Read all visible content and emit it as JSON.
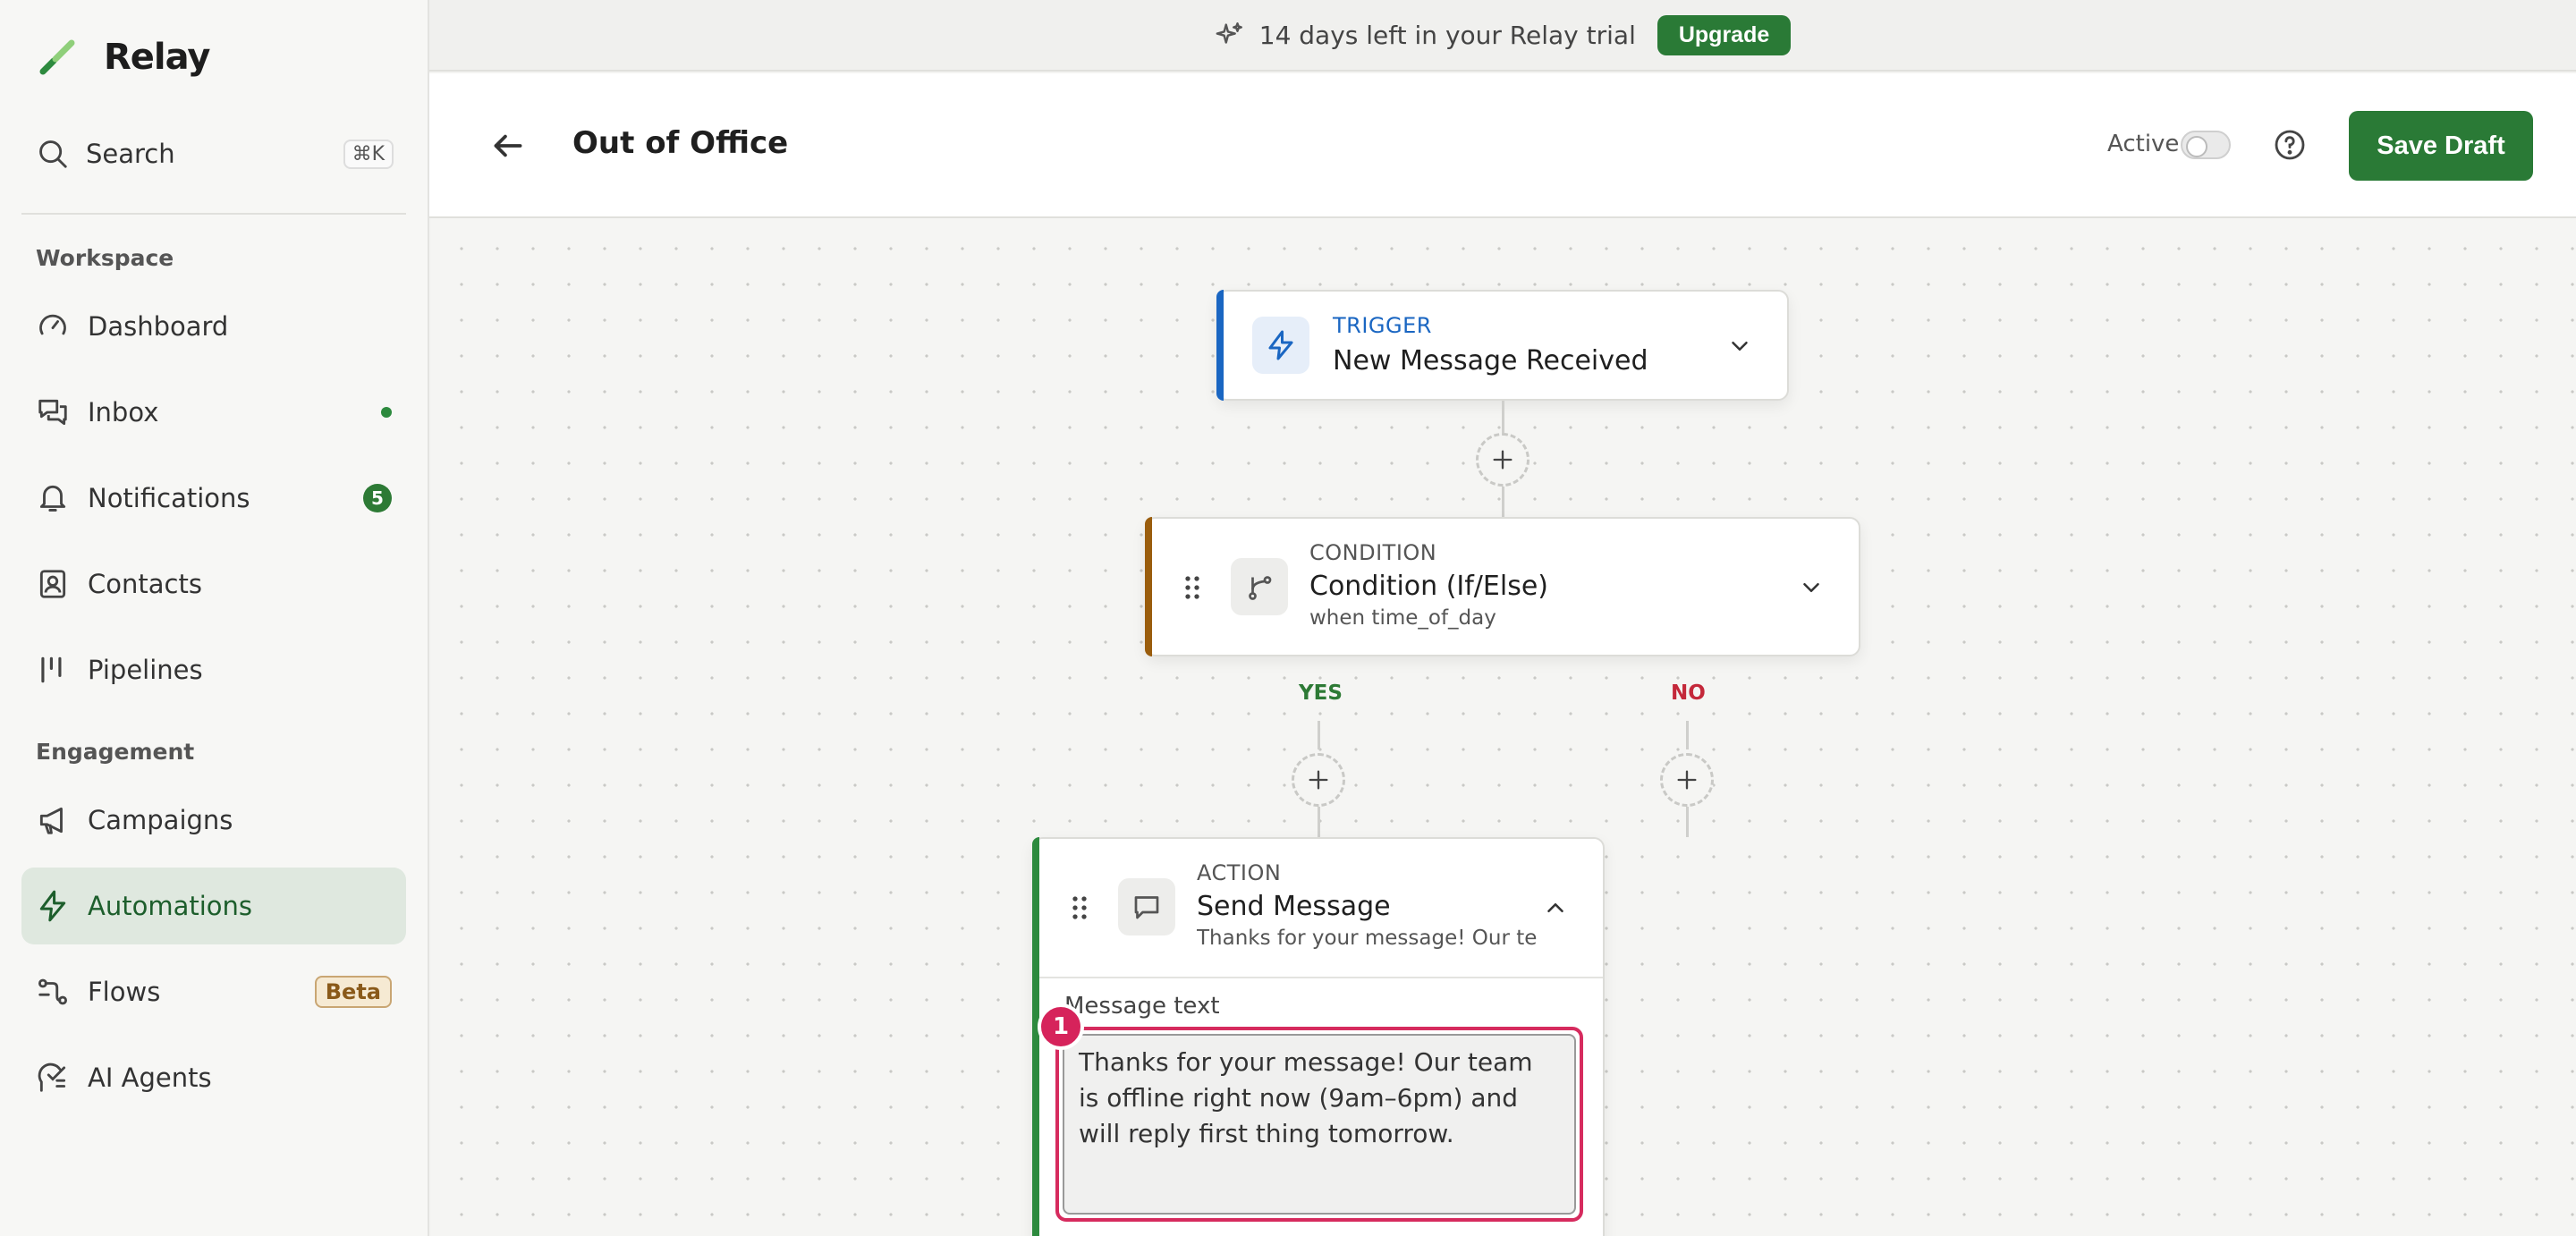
{
  "app": {
    "name": "Relay"
  },
  "search": {
    "label": "Search",
    "shortcut": "⌘K"
  },
  "sidebar": {
    "sections": [
      {
        "label": "Workspace"
      },
      {
        "label": "Engagement"
      }
    ],
    "items": [
      {
        "label": "Dashboard",
        "icon": "gauge-icon"
      },
      {
        "label": "Inbox",
        "icon": "chat-icon",
        "indicator": "dot"
      },
      {
        "label": "Notifications",
        "icon": "bell-icon",
        "count": "5"
      },
      {
        "label": "Contacts",
        "icon": "contact-card-icon"
      },
      {
        "label": "Pipelines",
        "icon": "pipeline-icon"
      },
      {
        "label": "Campaigns",
        "icon": "megaphone-icon"
      },
      {
        "label": "Automations",
        "icon": "bolt-icon",
        "active": true
      },
      {
        "label": "Flows",
        "icon": "flow-icon",
        "badge": "Beta"
      },
      {
        "label": "AI Agents",
        "icon": "ai-agent-icon"
      }
    ]
  },
  "trial_banner": {
    "text": "14 days left in your Relay trial",
    "button": "Upgrade"
  },
  "header": {
    "title": "Out of Office",
    "active_label": "Active",
    "active": false,
    "save_label": "Save Draft"
  },
  "flow": {
    "trigger": {
      "kind": "TRIGGER",
      "title": "New Message Received"
    },
    "condition": {
      "kind": "CONDITION",
      "title": "Condition (If/Else)",
      "subtitle": "when time_of_day"
    },
    "branches": {
      "yes": "YES",
      "no": "NO"
    },
    "action": {
      "kind": "ACTION",
      "title": "Send Message",
      "subtitle": "Thanks for your message! Our tea...",
      "field_label": "Message text",
      "message": "Thanks for your message! Our team is offline right now (9am–6pm) and will reply first thing tomorrow.",
      "badge": "1"
    }
  },
  "colors": {
    "brand_green": "#2a7a36",
    "trigger_accent": "#1a66c2",
    "condition_accent": "#9a5d0d",
    "action_accent": "#2d8a3e",
    "highlight": "#d62b5e"
  }
}
